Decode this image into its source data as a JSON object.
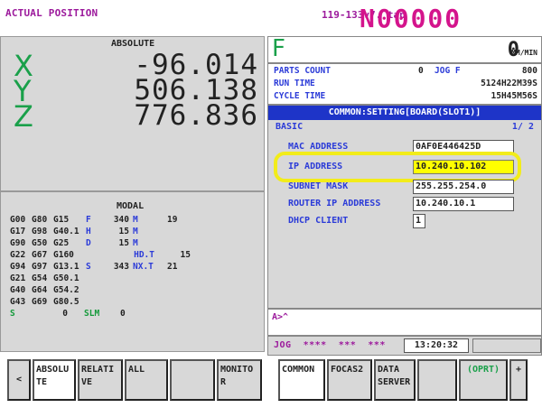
{
  "header": {
    "title": "ACTUAL POSITION",
    "program": "119-133v7. tap",
    "sequence": "N00000"
  },
  "position": {
    "heading": "ABSOLUTE",
    "axes": [
      {
        "label": "X",
        "value": "-96.014"
      },
      {
        "label": "Y",
        "value": "506.138"
      },
      {
        "label": "Z",
        "value": "776.836"
      }
    ]
  },
  "modal": {
    "heading": "MODAL",
    "rows": [
      [
        "G00",
        "G80",
        "G15",
        "F",
        "340",
        "M",
        "19"
      ],
      [
        "G17",
        "G98",
        "G40.1",
        "H",
        "15",
        "M",
        ""
      ],
      [
        "G90",
        "G50",
        "G25",
        "D",
        "15",
        "M",
        ""
      ],
      [
        "G22",
        "G67",
        "G160",
        "",
        "HD.T",
        "15",
        ""
      ],
      [
        "G94",
        "G97",
        "G13.1",
        "S",
        "343",
        "NX.T",
        "21"
      ],
      [
        "G21",
        "G54",
        "G50.1",
        "",
        "",
        "",
        ""
      ],
      [
        "G40",
        "G64",
        "G54.2",
        "",
        "",
        "",
        ""
      ],
      [
        "G43",
        "G69",
        "G80.5",
        "",
        "",
        "",
        ""
      ]
    ],
    "spindle_label": "S",
    "spindle_value": "0",
    "slm_label": "SLM",
    "slm_value": "0"
  },
  "feed": {
    "label": "F",
    "value": "0",
    "unit": "MM/MIN"
  },
  "info": {
    "parts_count_label": "PARTS COUNT",
    "parts_count_value": "0",
    "jog_label": "JOG F",
    "jog_value": "800",
    "run_time_label": "RUN TIME",
    "run_time_value": "5124H22M39S",
    "cycle_time_label": "CYCLE TIME",
    "cycle_time_value": "15H45M56S"
  },
  "setting": {
    "title": "COMMON:SETTING[BOARD(SLOT1)]",
    "section": "BASIC",
    "page": "1/ 2",
    "fields": [
      {
        "label": "MAC ADDRESS",
        "value": "0AF0E446425D"
      },
      {
        "label": "IP ADDRESS",
        "value": "10.240.10.102"
      },
      {
        "label": "SUBNET MASK",
        "value": "255.255.254.0"
      },
      {
        "label": "ROUTER IP ADDRESS",
        "value": "10.240.10.1"
      },
      {
        "label": "DHCP CLIENT",
        "value": "1"
      }
    ]
  },
  "input": {
    "prompt": "A>^"
  },
  "status": {
    "mode": "JOG  ****  ***  ***",
    "clock": "13:20:32"
  },
  "softkeys": {
    "left_arrow": "<",
    "absolute": "ABSOLU TE",
    "relative": "RELATI VE",
    "all": "ALL",
    "blank1": "",
    "monitor": "MONITO R",
    "common": "COMMON",
    "focas2": "FOCAS2",
    "data_server": "DATA SERVER",
    "blank2": "",
    "oprt": "(OPRT)",
    "plus": "+"
  }
}
